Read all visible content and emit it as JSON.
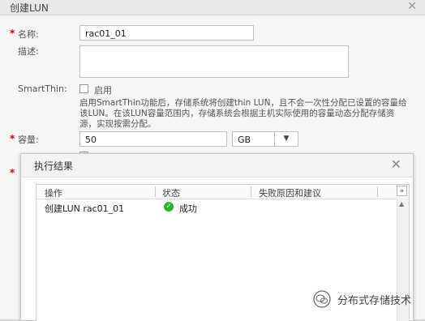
{
  "background_dialog": {
    "title": "创建LUN",
    "close_icon": "close-icon",
    "name": {
      "required_mark": "*",
      "label": "名称:",
      "value": "rac01_01"
    },
    "description": {
      "label": "描述:",
      "value": ""
    },
    "smartthin": {
      "label": "SmartThin:",
      "checkbox_label": "启用",
      "checked": false,
      "hint": "启用SmartThin功能后，存储系统将创建thin LUN，且不会一次性分配已设置的容量给该LUN。在该LUN容量范围内，存储系统会根据主机实际使用的容量动态分配存储资源，实现按需分配。"
    },
    "capacity": {
      "required_mark": "*",
      "label": "容量:",
      "value": "50",
      "unit": "GB"
    },
    "hidden_required_mark": "*"
  },
  "result_popup": {
    "title": "执行结果",
    "close_icon": "close-icon",
    "columns": [
      "操作",
      "状态",
      "失败原因和建议"
    ],
    "column_menu_icon": "double-chevron-down-icon",
    "rows": [
      {
        "operation": "创建LUN rac01_01",
        "status": "成功",
        "status_icon": "check-circle-icon",
        "reason": ""
      }
    ]
  },
  "watermark": {
    "text": "分布式存储技术",
    "icon": "wechat-logo-icon"
  },
  "colors": {
    "success": "#2eae3d",
    "required": "#d60000"
  }
}
